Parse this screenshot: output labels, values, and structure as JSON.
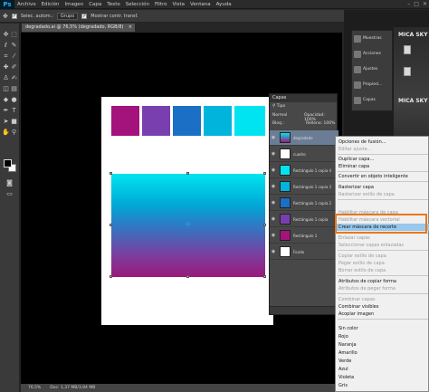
{
  "app": {
    "logo": "Ps",
    "menu": [
      "Archivo",
      "Edición",
      "Imagen",
      "Capa",
      "Texto",
      "Selección",
      "Filtro",
      "Vista",
      "Ventana",
      "Ayuda"
    ],
    "window_controls": [
      "–",
      "□",
      "✕"
    ]
  },
  "options_bar": {
    "tool_icon": "move-tool-icon",
    "auto_select_label": "Selec. autom.:",
    "auto_select_value": "Grupo",
    "transform_label": "Mostrar contr. transf."
  },
  "document": {
    "tab_title": "degradado.ai @ 76,5% (degradado, RGB/8)",
    "tab_close": "×",
    "swatches": [
      "#a4127c",
      "#7a3fae",
      "#1b6fc4",
      "#00b4dc",
      "#00e4f2"
    ],
    "zoom": "76,5%",
    "doc_size": "Doc: 1,37 MB/3,94 MB"
  },
  "mini_panel": {
    "items": [
      {
        "label": "Muestras",
        "icon": "swatches-icon"
      },
      {
        "label": "Acciones",
        "icon": "actions-icon"
      },
      {
        "label": "Ajustes",
        "icon": "adjustments-icon"
      },
      {
        "label": "Propied...",
        "icon": "properties-icon"
      },
      {
        "label": "Capas",
        "icon": "layers-icon"
      }
    ]
  },
  "background": {
    "texts": [
      "MICA SKY",
      "MICA SKY"
    ]
  },
  "layers_panel": {
    "title": "Capas",
    "filter_label": "Tipo",
    "blend_mode": "Normal",
    "opacity_label": "Opacidad:",
    "opacity_value": "100%",
    "lock_label": "Bloq.:",
    "fill_label": "Relleno:",
    "fill_value": "100%",
    "layers": [
      {
        "name": "degradado",
        "thumb": "linear-gradient(#00e5f0,#9a1a7a)"
      },
      {
        "name": "cuadro",
        "thumb": "#ffffff"
      },
      {
        "name": "Rectángulo 1 copia 4",
        "thumb": "#00e4f2"
      },
      {
        "name": "Rectángulo 1 copia 3",
        "thumb": "#00b4dc"
      },
      {
        "name": "Rectángulo 1 copia 2",
        "thumb": "#1b6fc4"
      },
      {
        "name": "Rectángulo 1 copia",
        "thumb": "#7a3fae"
      },
      {
        "name": "Rectángulo 1",
        "thumb": "#a4127c"
      },
      {
        "name": "Fondo",
        "thumb": "#ffffff"
      }
    ]
  },
  "context_menu": {
    "items": [
      {
        "label": "Opciones de fusión...",
        "enabled": true
      },
      {
        "label": "Editar ajuste...",
        "enabled": false
      },
      {
        "label": "Duplicar capa...",
        "enabled": true
      },
      {
        "label": "Eliminar capa",
        "enabled": true
      },
      {
        "label": "Convertir en objeto inteligente",
        "enabled": true
      },
      {
        "label": "Rasterizar capa",
        "enabled": true
      },
      {
        "label": "Rasterizar estilo de capa",
        "enabled": false
      },
      {
        "label": "Habilitar máscara de capa",
        "enabled": false
      },
      {
        "label": "Habilitar máscara vectorial",
        "enabled": false
      },
      {
        "label": "Crear máscara de recorte",
        "enabled": true,
        "highlighted": true
      },
      {
        "label": "Enlazar capas",
        "enabled": false
      },
      {
        "label": "Seleccionar capas enlazadas",
        "enabled": false
      },
      {
        "label": "Copiar estilo de capa",
        "enabled": false
      },
      {
        "label": "Pegar estilo de capa",
        "enabled": false
      },
      {
        "label": "Borrar estilo de capa",
        "enabled": false
      },
      {
        "label": "Atributos de copiar forma",
        "enabled": true
      },
      {
        "label": "Atributos de pegar forma",
        "enabled": false
      },
      {
        "label": "Combinar capas",
        "enabled": false
      },
      {
        "label": "Combinar visibles",
        "enabled": true
      },
      {
        "label": "Acoplar imagen",
        "enabled": true
      },
      {
        "label": "Sin color",
        "enabled": true
      },
      {
        "label": "Rojo",
        "enabled": true
      },
      {
        "label": "Naranja",
        "enabled": true
      },
      {
        "label": "Amarillo",
        "enabled": true
      },
      {
        "label": "Verde",
        "enabled": true
      },
      {
        "label": "Azul",
        "enabled": true
      },
      {
        "label": "Violeta",
        "enabled": true
      },
      {
        "label": "Gris",
        "enabled": true
      }
    ],
    "highlight_color": "#98c8ec",
    "callout_color": "#e8781e"
  }
}
